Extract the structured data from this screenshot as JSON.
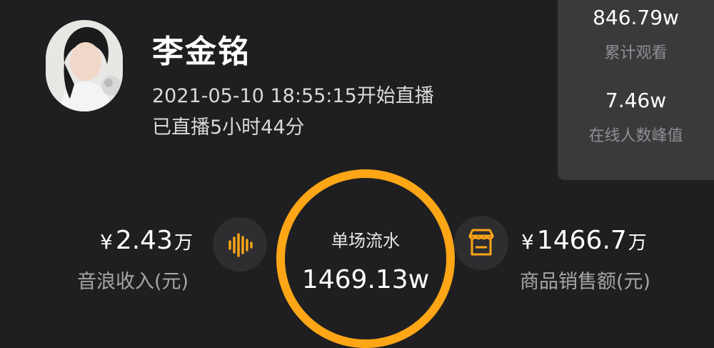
{
  "streamer": {
    "name": "李金铭",
    "start_time": "2021-05-10 18:55:15开始直播",
    "duration": "已直播5小时44分"
  },
  "stats_panel": {
    "total_views": {
      "value": "846.79w",
      "label": "累计观看"
    },
    "peak_online": {
      "value": "7.46w",
      "label": "在线人数峰值"
    }
  },
  "sound_wave_income": {
    "currency": "¥",
    "amount": "2.43",
    "unit": "万",
    "label": "音浪收入(元)"
  },
  "gmv": {
    "label": "单场流水",
    "value": "1469.13w",
    "ring_color": "#ffa616"
  },
  "product_sales": {
    "currency": "¥",
    "amount": "1466.7",
    "unit": "万",
    "label": "商品销售额(元)"
  },
  "icons": {
    "sound_wave": "sound-wave-icon",
    "store": "store-icon"
  },
  "colors": {
    "accent": "#ffa616",
    "background": "#1f1f21",
    "panel": "#3a3a3c"
  }
}
